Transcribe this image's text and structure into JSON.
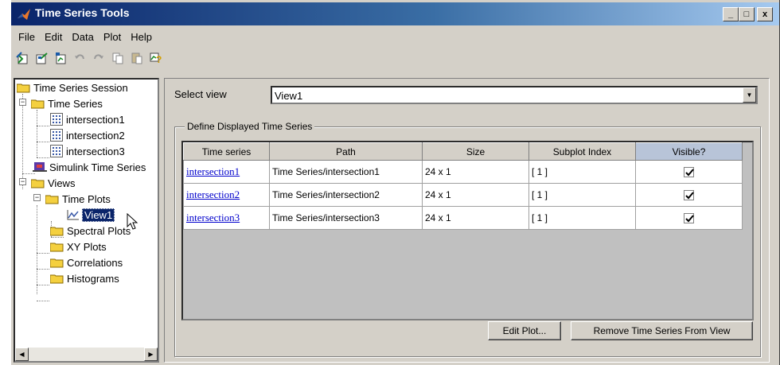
{
  "window": {
    "title": "Time Series Tools"
  },
  "title_buttons": {
    "minimize": "_",
    "maximize": "□",
    "close": "x"
  },
  "menu": [
    "File",
    "Edit",
    "Data",
    "Plot",
    "Help"
  ],
  "toolbar_icons": [
    "import-data-icon",
    "export-data-icon",
    "new-view-icon",
    "undo-icon",
    "redo-icon",
    "copy-icon",
    "paste-icon",
    "help-icon"
  ],
  "tree": {
    "root": "Time Series Session",
    "time_series": "Time Series",
    "series_items": [
      "intersection1",
      "intersection2",
      "intersection3"
    ],
    "simulink": "Simulink Time Series",
    "views": "Views",
    "time_plots": "Time Plots",
    "view1": "View1",
    "other_views": [
      "Spectral Plots",
      "XY Plots",
      "Correlations",
      "Histograms"
    ]
  },
  "select_view": {
    "label": "Select view",
    "value": "View1"
  },
  "group": {
    "title": "Define Displayed Time Series"
  },
  "table": {
    "columns": [
      "Time series",
      "Path",
      "Size",
      "Subplot Index",
      "Visible?"
    ],
    "rows": [
      {
        "name": "intersection1",
        "path": "Time Series/intersection1",
        "size": "24 x 1",
        "subplot": "[ 1 ]",
        "visible": true
      },
      {
        "name": "intersection2",
        "path": "Time Series/intersection2",
        "size": "24 x 1",
        "subplot": "[ 1 ]",
        "visible": true
      },
      {
        "name": "intersection3",
        "path": "Time Series/intersection3",
        "size": "24 x 1",
        "subplot": "[ 1 ]",
        "visible": true
      }
    ]
  },
  "buttons": {
    "edit_plot": "Edit Plot...",
    "remove": "Remove Time Series From View"
  },
  "colors": {
    "title_start": "#0a246a",
    "title_end": "#a6caf0",
    "link": "#0000cc",
    "selection": "#0a246a"
  }
}
